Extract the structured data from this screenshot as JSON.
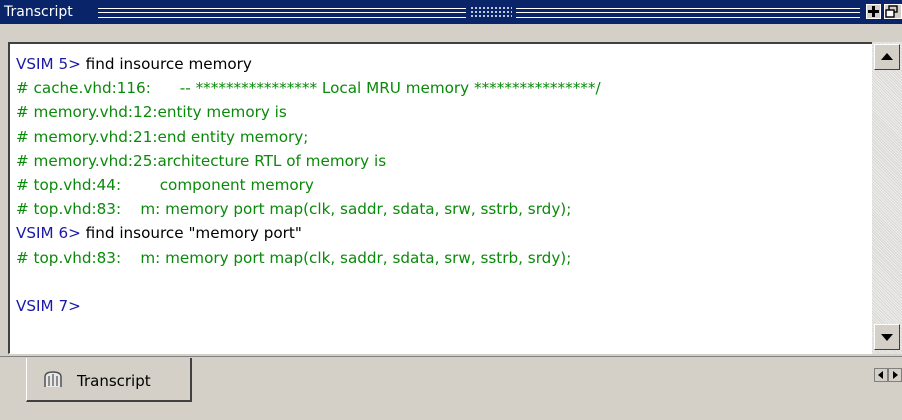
{
  "window": {
    "title": "Transcript",
    "buttons": {
      "dock_icon": "plus-box-icon",
      "undock_icon": "restore-window-icon"
    }
  },
  "transcript": {
    "lines": [
      {
        "prompt": "VSIM 5>",
        "text": " find insource memory",
        "kind": "command"
      },
      {
        "prompt": "",
        "text": "# cache.vhd:116:      -- **************** Local MRU memory ****************/",
        "kind": "output"
      },
      {
        "prompt": "",
        "text": "# memory.vhd:12:entity memory is",
        "kind": "output"
      },
      {
        "prompt": "",
        "text": "# memory.vhd:21:end entity memory;",
        "kind": "output"
      },
      {
        "prompt": "",
        "text": "# memory.vhd:25:architecture RTL of memory is",
        "kind": "output"
      },
      {
        "prompt": "",
        "text": "# top.vhd:44:        component memory",
        "kind": "output"
      },
      {
        "prompt": "",
        "text": "# top.vhd:83:    m: memory port map(clk, saddr, sdata, srw, sstrb, srdy);",
        "kind": "output"
      },
      {
        "prompt": "VSIM 6>",
        "text": " find insource \"memory port\"",
        "kind": "command"
      },
      {
        "prompt": "",
        "text": "# top.vhd:83:    m: memory port map(clk, saddr, sdata, srw, sstrb, srdy);",
        "kind": "output"
      },
      {
        "prompt": "",
        "text": "",
        "kind": "blank"
      },
      {
        "prompt": "VSIM 7>",
        "text": "",
        "kind": "command"
      }
    ]
  },
  "tabs": [
    {
      "label": "Transcript",
      "icon": "transcript-tab-icon",
      "active": true
    }
  ],
  "colors": {
    "titlebar": "#0a246a",
    "prompt": "#1a1aa6",
    "output": "#0a8a0a",
    "command": "#000000"
  }
}
